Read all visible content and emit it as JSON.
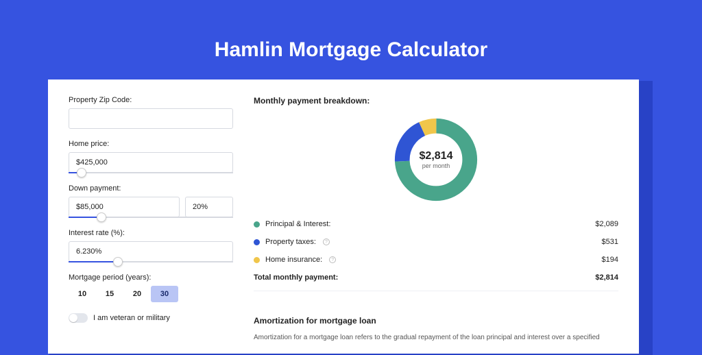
{
  "page_title": "Hamlin Mortgage Calculator",
  "form": {
    "zip_label": "Property Zip Code:",
    "zip_value": "",
    "home_price_label": "Home price:",
    "home_price_value": "$425,000",
    "home_price_pct": 8,
    "down_label": "Down payment:",
    "down_value": "$85,000",
    "down_pct_value": "20%",
    "down_slider_pct": 20,
    "rate_label": "Interest rate (%):",
    "rate_value": "6.230%",
    "rate_slider_pct": 30,
    "period_label": "Mortgage period (years):",
    "period_options": [
      "10",
      "15",
      "20",
      "30"
    ],
    "period_selected": "30",
    "veteran_label": "I am veteran or military",
    "veteran_on": false
  },
  "breakdown": {
    "title": "Monthly payment breakdown:",
    "total_amount": "$2,814",
    "total_sub": "per month",
    "items": [
      {
        "label": "Principal & Interest:",
        "value": "$2,089",
        "color": "#49a58b",
        "info": false
      },
      {
        "label": "Property taxes:",
        "value": "$531",
        "color": "#2f55d4",
        "info": true
      },
      {
        "label": "Home insurance:",
        "value": "$194",
        "color": "#f0c64b",
        "info": true
      }
    ],
    "total_label": "Total monthly payment:",
    "total_value": "$2,814"
  },
  "chart_data": {
    "type": "pie",
    "title": "Monthly payment breakdown",
    "categories": [
      "Principal & Interest",
      "Property taxes",
      "Home insurance"
    ],
    "values": [
      2089,
      531,
      194
    ],
    "colors": [
      "#49a58b",
      "#2f55d4",
      "#f0c64b"
    ]
  },
  "amortization": {
    "title": "Amortization for mortgage loan",
    "text": "Amortization for a mortgage loan refers to the gradual repayment of the loan principal and interest over a specified"
  }
}
